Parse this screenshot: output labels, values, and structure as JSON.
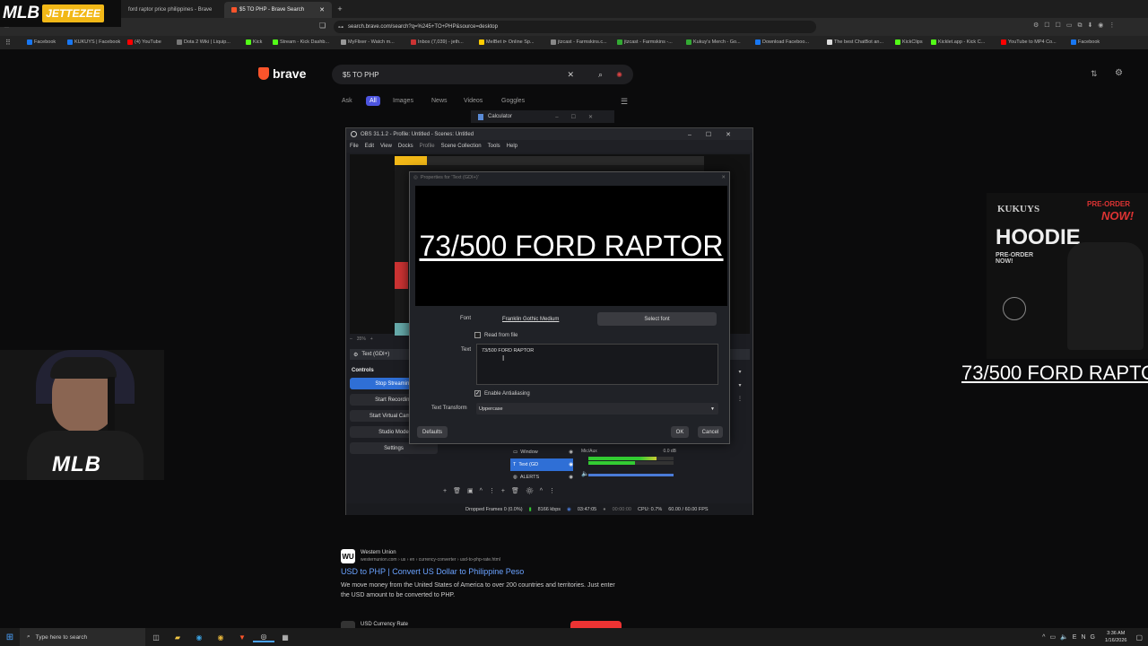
{
  "browser": {
    "tabs": [
      {
        "label": "ford raptor price philippines - Brave"
      },
      {
        "label": "$5 TO PHP - Brave Search"
      }
    ],
    "url": "search.brave.com/search?q=%245+TO+PHP&source=desktop",
    "bookmarks": [
      "Facebook",
      "KUKUYS | Facebook",
      "(4) YouTube",
      "Dota 2 Wiki | Liquip...",
      "Kick",
      "Stream - Kick Dashb...",
      "MyFlixer - Watch m...",
      "Inbox (7,039) - jeth...",
      "MelBet ⊳ Online Sp...",
      "jtzcast - Farmskins.c...",
      "jtzcast - Farmskins -...",
      "Kukuy's Merch - Go...",
      "Download Faceboo...",
      "The best ChatBot an...",
      "KickClips",
      "Kicklet.app - Kick C...",
      "YouTube to MP4 Co...",
      "Facebook"
    ]
  },
  "brave": {
    "logo": "brave",
    "query": "$5 TO PHP",
    "nav": [
      "Ask",
      "All",
      "Images",
      "News",
      "Videos",
      "Goggles"
    ],
    "result": {
      "site": "Western Union",
      "breadcrumb": "westernunion.com › us › en › currency-converter › usd-to-php-rate.html",
      "title": "USD to PHP | Convert US Dollar to Philippine Peso",
      "snippet": "We move money from the United States of America to over 200 countries and territories. Just enter the USD amount to be converted to PHP.",
      "next_site": "USD Currency Rate"
    }
  },
  "calculator": {
    "title": "Calculator"
  },
  "overlay": {
    "logo_left": "MLB",
    "logo_right": "JETTEZEE",
    "cam_logo": "MLB",
    "ticker": "73/500 FORD RAPTOR",
    "ad_lines": [
      "KUKUYS",
      "HOODIE",
      "PRE-ORDER",
      "NOW!",
      "PRE-ORDER NOW!"
    ]
  },
  "obs": {
    "title": "OBS 31.1.2 - Profile: Untitled - Scenes: Untitled",
    "menu": [
      "File",
      "Edit",
      "View",
      "Docks",
      "Profile",
      "Scene Collection",
      "Tools",
      "Help"
    ],
    "source_selected": "Text (GDI+)",
    "controls_label": "Controls",
    "controls": [
      "Stop Streaming",
      "Start Recording",
      "Start Virtual Camera",
      "Studio Mode",
      "Settings"
    ],
    "sources": [
      "Window",
      "Text (GD",
      "ALERTS"
    ],
    "mixer": {
      "label": "Mic/Aux",
      "db": "0.0 dB"
    },
    "zoom": "35%",
    "status": {
      "dropped": "Dropped Frames 0 (0.0%)",
      "kbps": "8166 kbps",
      "stream_time": "03:47:05",
      "rec_time": "00:00:00",
      "cpu": "CPU: 0.7%",
      "fps": "60.00 / 60.00 FPS"
    }
  },
  "props": {
    "title": "Properties for 'Text (GDI+)'",
    "preview_text": "73/500 FORD RAPTOR",
    "font_label": "Font",
    "font_value": "Franklin Gothic Medium",
    "select_font": "Select font",
    "read_from_file": "Read from file",
    "text_label": "Text",
    "text_value": "73/500 FORD RAPTOR",
    "antialias": "Enable Antialiasing",
    "transform_label": "Text Transform",
    "transform_value": "Uppercase",
    "defaults": "Defaults",
    "ok": "OK",
    "cancel": "Cancel"
  },
  "taskbar": {
    "search_placeholder": "Type here to search",
    "time": "3:36 AM",
    "date": "1/16/2026"
  },
  "colors": {
    "brave_orange": "#fb542b",
    "obs_blue": "#2f6fd6",
    "link_blue": "#6aa2ff"
  }
}
